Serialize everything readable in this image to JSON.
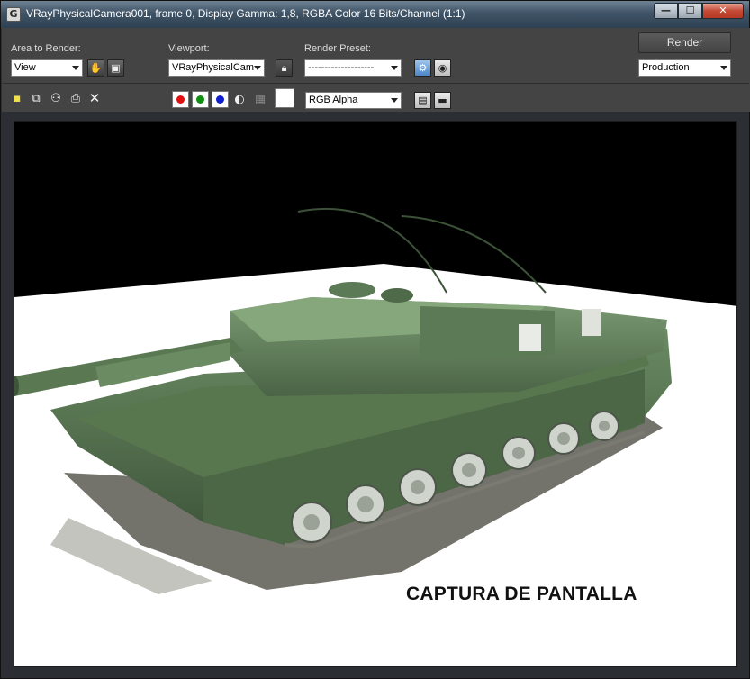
{
  "window": {
    "title": "VRayPhysicalCamera001, frame 0, Display Gamma: 1,8, RGBA Color 16 Bits/Channel (1:1)",
    "icon": "3dsmax-app-icon",
    "minimize_glyph": "—",
    "maximize_glyph": "☐",
    "close_glyph": "✕"
  },
  "toolbar": {
    "area_to_render_label": "Area to Render:",
    "area_to_render_value": "View",
    "viewport_label": "Viewport:",
    "viewport_value": "VRayPhysicalCam",
    "render_preset_label": "Render Preset:",
    "render_preset_value": "--------------------",
    "render_button": "Render",
    "production_value": "Production",
    "channel_value": "RGB Alpha"
  },
  "channels": {
    "red": "#e01010",
    "green": "#109010",
    "blue": "#1020d0"
  },
  "render": {
    "caption": "CAPTURA DE PANTALLA",
    "background": "#000000",
    "floor": "#ffffff",
    "tank_color": "#4d6a48"
  }
}
